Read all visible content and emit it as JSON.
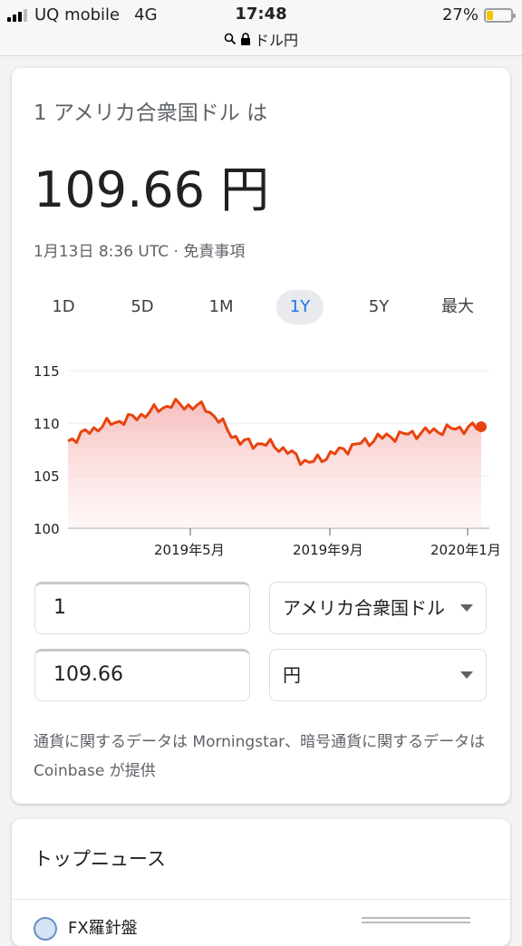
{
  "status_bar": {
    "carrier": "UQ mobile",
    "network": "4G",
    "time": "17:48",
    "battery_percent": "27%",
    "battery_level": 0.27,
    "url": "ドル円"
  },
  "converter_card": {
    "heading": "1 アメリカ合衆国ドル は",
    "rate": "109.66 円",
    "timestamp": "1月13日 8:36 UTC · 免責事項",
    "tabs": [
      {
        "label": "1D",
        "active": false
      },
      {
        "label": "5D",
        "active": false
      },
      {
        "label": "1M",
        "active": false
      },
      {
        "label": "1Y",
        "active": true
      },
      {
        "label": "5Y",
        "active": false
      },
      {
        "label": "最大",
        "active": false
      }
    ],
    "accent_color": "#1a73e8",
    "line_color": "#e8430e",
    "from_amount": "1",
    "from_currency": "アメリカ合衆国ドル",
    "to_amount": "109.66",
    "to_currency": "円",
    "attribution": "通貨に関するデータは Morningstar、暗号通貨に関するデータは Coinbase が提供"
  },
  "chart_data": {
    "type": "area",
    "y_ticks": [
      "115",
      "110",
      "105",
      "100"
    ],
    "ylim": [
      100,
      115
    ],
    "x_ticks": [
      "2019年5月",
      "2019年9月",
      "2020年1月"
    ],
    "grid": true,
    "x": [
      "2019-01",
      "2019-02",
      "2019-03",
      "2019-04",
      "2019-05",
      "2019-06",
      "2019-07",
      "2019-08",
      "2019-09",
      "2019-10",
      "2019-11",
      "2019-12",
      "2020-01"
    ],
    "values": [
      108.3,
      109.8,
      110.6,
      111.8,
      111.5,
      108.2,
      107.9,
      106.2,
      107.5,
      108.6,
      109.0,
      109.4,
      109.66
    ]
  },
  "news": {
    "title": "トップニュース",
    "first_source": "FX羅針盤"
  }
}
